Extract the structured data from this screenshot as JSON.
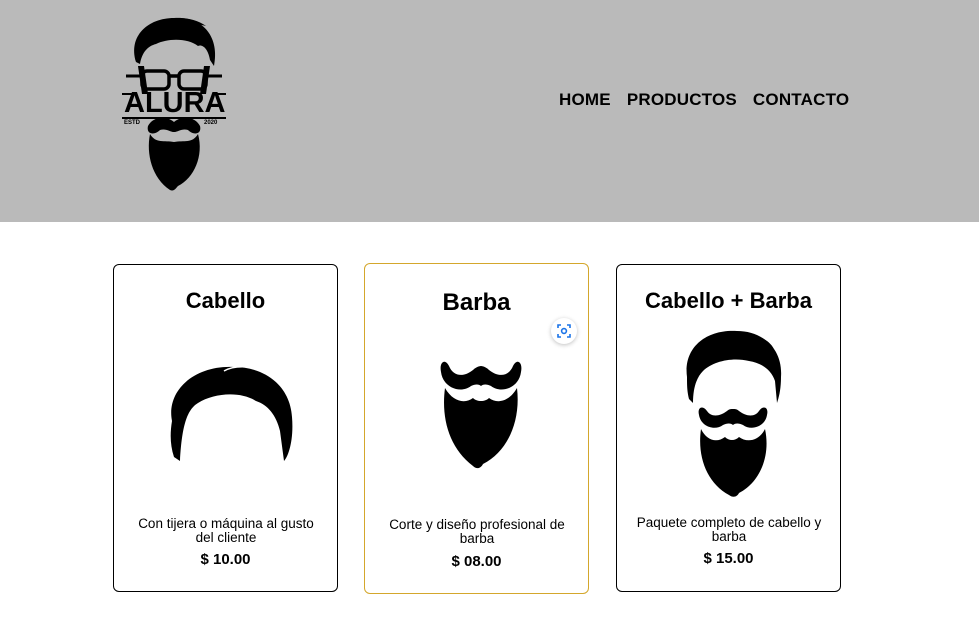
{
  "logo": {
    "name": "ALURA",
    "estd": "ESTD",
    "year": "2020"
  },
  "nav": {
    "items": [
      {
        "label": "HOME"
      },
      {
        "label": "PRODUCTOS"
      },
      {
        "label": "CONTACTO"
      }
    ]
  },
  "products": [
    {
      "title": "Cabello",
      "description": "Con tijera o máquina al gusto del cliente",
      "price": "$ 10.00",
      "icon": "hair-icon"
    },
    {
      "title": "Barba",
      "description": "Corte y diseño profesional de barba",
      "price": "$ 08.00",
      "icon": "beard-icon"
    },
    {
      "title": "Cabello + Barba",
      "description": "Paquete completo de cabello y barba",
      "price": "$ 15.00",
      "icon": "hair-and-beard-icon"
    }
  ],
  "colors": {
    "header_bg": "#bababa",
    "active_border": "#d4a72c",
    "lens_accent": "#1a73e8"
  }
}
